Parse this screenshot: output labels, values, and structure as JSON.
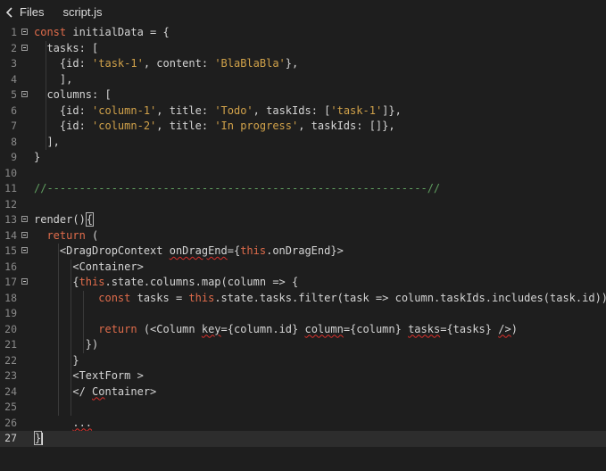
{
  "topbar": {
    "back_label": "Files",
    "tab_label": "script.js"
  },
  "icons": {
    "back": "chevron-left-icon",
    "fold": "fold-toggle-icon"
  },
  "colors": {
    "background": "#1e1e1e",
    "keyword": "#e06c4b",
    "string": "#d1a24a",
    "comment": "#60a060",
    "text": "#d4d4d4",
    "error_squiggle": "#d9302b"
  },
  "editor": {
    "current_line": 27,
    "lines": [
      {
        "num": "1",
        "fold": true,
        "segments": [
          {
            "t": "const ",
            "c": "kw"
          },
          {
            "t": "initialData = {"
          }
        ]
      },
      {
        "num": "2",
        "fold": true,
        "segments": [
          {
            "t": "  tasks: ["
          }
        ]
      },
      {
        "num": "3",
        "fold": false,
        "segments": [
          {
            "t": "    {id: "
          },
          {
            "t": "'task-1'",
            "c": "str"
          },
          {
            "t": ", content: "
          },
          {
            "t": "'BlaBlaBla'",
            "c": "str"
          },
          {
            "t": "},"
          }
        ]
      },
      {
        "num": "4",
        "fold": false,
        "segments": [
          {
            "t": "    ],"
          }
        ]
      },
      {
        "num": "5",
        "fold": true,
        "segments": [
          {
            "t": "  columns: ["
          }
        ]
      },
      {
        "num": "6",
        "fold": false,
        "segments": [
          {
            "t": "    {id: "
          },
          {
            "t": "'column-1'",
            "c": "str"
          },
          {
            "t": ", title: "
          },
          {
            "t": "'Todo'",
            "c": "str"
          },
          {
            "t": ", taskIds: ["
          },
          {
            "t": "'task-1'",
            "c": "str"
          },
          {
            "t": "]},"
          }
        ]
      },
      {
        "num": "7",
        "fold": false,
        "segments": [
          {
            "t": "    {id: "
          },
          {
            "t": "'column-2'",
            "c": "str"
          },
          {
            "t": ", title: "
          },
          {
            "t": "'In progress'",
            "c": "str"
          },
          {
            "t": ", taskIds: []},"
          }
        ]
      },
      {
        "num": "8",
        "fold": false,
        "segments": [
          {
            "t": "  ],"
          }
        ]
      },
      {
        "num": "9",
        "fold": false,
        "segments": [
          {
            "t": "}"
          }
        ]
      },
      {
        "num": "10",
        "fold": false,
        "segments": [
          {
            "t": ""
          }
        ]
      },
      {
        "num": "11",
        "fold": false,
        "segments": [
          {
            "t": "//-----------------------------------------------------------//",
            "c": "cm"
          }
        ]
      },
      {
        "num": "12",
        "fold": false,
        "segments": [
          {
            "t": ""
          }
        ]
      },
      {
        "num": "13",
        "fold": true,
        "segments": [
          {
            "t": "render()"
          },
          {
            "t": "{",
            "c": "box"
          }
        ]
      },
      {
        "num": "14",
        "fold": true,
        "segments": [
          {
            "t": "  "
          },
          {
            "t": "return",
            "c": "kw"
          },
          {
            "t": " ("
          }
        ]
      },
      {
        "num": "15",
        "fold": true,
        "segments": [
          {
            "t": "    <DragDropContext "
          },
          {
            "t": "onDragEnd",
            "c": "sq"
          },
          {
            "t": "={"
          },
          {
            "t": "this",
            "c": "kw"
          },
          {
            "t": ".onDragEnd}>"
          }
        ]
      },
      {
        "num": "16",
        "fold": false,
        "segments": [
          {
            "t": "      <Container>"
          }
        ]
      },
      {
        "num": "17",
        "fold": true,
        "segments": [
          {
            "t": "      {"
          },
          {
            "t": "this",
            "c": "kw"
          },
          {
            "t": ".state.columns.map(column => {"
          }
        ]
      },
      {
        "num": "18",
        "fold": false,
        "segments": [
          {
            "t": "          "
          },
          {
            "t": "const",
            "c": "kw"
          },
          {
            "t": " tasks = "
          },
          {
            "t": "this",
            "c": "kw"
          },
          {
            "t": ".state.tasks.filter(task => column.taskIds.includes(task.id))"
          }
        ]
      },
      {
        "num": "19",
        "fold": false,
        "segments": [
          {
            "t": ""
          }
        ]
      },
      {
        "num": "20",
        "fold": false,
        "segments": [
          {
            "t": "          "
          },
          {
            "t": "return",
            "c": "kw"
          },
          {
            "t": " (<Column "
          },
          {
            "t": "key",
            "c": "sq"
          },
          {
            "t": "={column.id} "
          },
          {
            "t": "column",
            "c": "sq"
          },
          {
            "t": "={column} "
          },
          {
            "t": "tasks",
            "c": "sq"
          },
          {
            "t": "={tasks} "
          },
          {
            "t": "/>",
            "c": "sq"
          },
          {
            "t": ")"
          }
        ]
      },
      {
        "num": "21",
        "fold": false,
        "segments": [
          {
            "t": "        })"
          }
        ]
      },
      {
        "num": "22",
        "fold": false,
        "segments": [
          {
            "t": "      }"
          }
        ]
      },
      {
        "num": "23",
        "fold": false,
        "segments": [
          {
            "t": "      <TextForm >"
          }
        ]
      },
      {
        "num": "24",
        "fold": false,
        "segments": [
          {
            "t": "      </ "
          },
          {
            "t": "Container>",
            "c": "sqfirst"
          }
        ]
      },
      {
        "num": "25",
        "fold": false,
        "segments": [
          {
            "t": ""
          }
        ]
      },
      {
        "num": "26",
        "fold": false,
        "segments": [
          {
            "t": "      "
          },
          {
            "t": "...",
            "c": "sq"
          }
        ]
      },
      {
        "num": "27",
        "fold": false,
        "segments": [
          {
            "t": "}",
            "c": "box"
          }
        ]
      }
    ]
  }
}
